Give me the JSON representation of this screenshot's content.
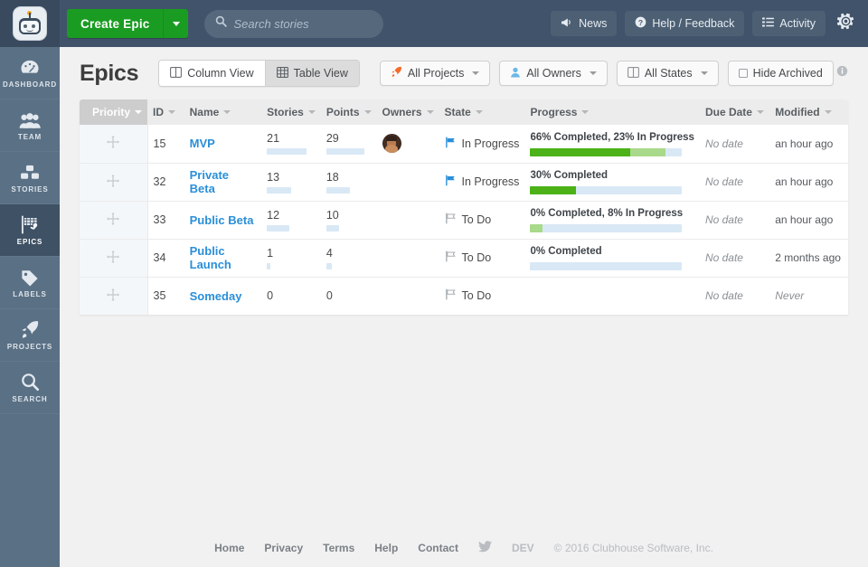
{
  "topbar": {
    "logo": "clubhouse-robot-logo",
    "create_label": "Create Epic",
    "create_caret": "chevron-down-icon",
    "search": {
      "value": "",
      "placeholder": "Search stories"
    },
    "buttons": [
      {
        "label": "News",
        "icon": "megaphone-icon"
      },
      {
        "label": "Help / Feedback",
        "icon": "help-circle-icon"
      },
      {
        "label": "Activity",
        "icon": "list-icon"
      }
    ],
    "settings_icon": "gear-icon"
  },
  "sidebar": {
    "items": [
      {
        "label": "DASHBOARD",
        "icon": "dashboard-icon",
        "active": false
      },
      {
        "label": "TEAM",
        "icon": "team-icon",
        "active": false
      },
      {
        "label": "STORIES",
        "icon": "stories-icon",
        "active": false
      },
      {
        "label": "EPICS",
        "icon": "epics-flag-icon",
        "active": true
      },
      {
        "label": "LABELS",
        "icon": "label-tag-icon",
        "active": false
      },
      {
        "label": "PROJECTS",
        "icon": "rocket-icon",
        "active": false
      },
      {
        "label": "SEARCH",
        "icon": "search-icon",
        "active": false
      }
    ]
  },
  "toolbar": {
    "title": "Epics",
    "views": [
      {
        "label": "Column View",
        "icon": "columns-icon",
        "active": false
      },
      {
        "label": "Table View",
        "icon": "table-grid-icon",
        "active": true
      }
    ],
    "filters": [
      {
        "label": "All Projects",
        "icon": "rocket-icon",
        "caret": true
      },
      {
        "label": "All Owners",
        "icon": "person-icon",
        "caret": true
      },
      {
        "label": "All States",
        "icon": "columns-icon",
        "caret": true
      },
      {
        "label": "Hide Archived",
        "icon": "checkbox-icon",
        "caret": false
      }
    ],
    "info_icon": "info-icon"
  },
  "table": {
    "columns": [
      {
        "key": "priority",
        "label": "Priority",
        "sorted": true
      },
      {
        "key": "id",
        "label": "ID",
        "sorted": false
      },
      {
        "key": "name",
        "label": "Name",
        "sorted": false
      },
      {
        "key": "stories",
        "label": "Stories",
        "sorted": false
      },
      {
        "key": "points",
        "label": "Points",
        "sorted": false
      },
      {
        "key": "owners",
        "label": "Owners",
        "sorted": false
      },
      {
        "key": "state",
        "label": "State",
        "sorted": false
      },
      {
        "key": "progress",
        "label": "Progress",
        "sorted": false
      },
      {
        "key": "due_date",
        "label": "Due Date",
        "sorted": false
      },
      {
        "key": "modified",
        "label": "Modified",
        "sorted": false
      }
    ],
    "rows": [
      {
        "drag_icon": "drag-handle-icon",
        "id": "15",
        "name": "MVP",
        "stories": "21",
        "stories_pct": 100,
        "points": "29",
        "points_pct": 100,
        "owner_avatar": true,
        "state": "In Progress",
        "state_icon": "flag-filled-icon",
        "progress_label": "66% Completed, 23% In Progress",
        "completed_pct": 66,
        "in_progress_pct": 23,
        "has_progress_bar": true,
        "due_date": "No date",
        "modified": "an hour ago"
      },
      {
        "drag_icon": "drag-handle-icon",
        "id": "32",
        "name": "Private Beta",
        "stories": "13",
        "stories_pct": 62,
        "points": "18",
        "points_pct": 62,
        "owner_avatar": false,
        "state": "In Progress",
        "state_icon": "flag-filled-icon",
        "progress_label": "30% Completed",
        "completed_pct": 30,
        "in_progress_pct": 0,
        "has_progress_bar": true,
        "due_date": "No date",
        "modified": "an hour ago"
      },
      {
        "drag_icon": "drag-handle-icon",
        "id": "33",
        "name": "Public Beta",
        "stories": "12",
        "stories_pct": 57,
        "points": "10",
        "points_pct": 34,
        "owner_avatar": false,
        "state": "To Do",
        "state_icon": "flag-outline-icon",
        "progress_label": "0% Completed, 8% In Progress",
        "completed_pct": 0,
        "in_progress_pct": 8,
        "has_progress_bar": true,
        "due_date": "No date",
        "modified": "an hour ago"
      },
      {
        "drag_icon": "drag-handle-icon",
        "id": "34",
        "name": "Public Launch",
        "stories": "1",
        "stories_pct": 5,
        "points": "4",
        "points_pct": 14,
        "owner_avatar": false,
        "state": "To Do",
        "state_icon": "flag-outline-icon",
        "progress_label": "0% Completed",
        "completed_pct": 0,
        "in_progress_pct": 0,
        "has_progress_bar": true,
        "due_date": "No date",
        "modified": "2 months ago"
      },
      {
        "drag_icon": "drag-handle-icon",
        "id": "35",
        "name": "Someday",
        "stories": "0",
        "stories_pct": 0,
        "points": "0",
        "points_pct": 0,
        "owner_avatar": false,
        "state": "To Do",
        "state_icon": "flag-outline-icon",
        "progress_label": "",
        "completed_pct": 0,
        "in_progress_pct": 0,
        "has_progress_bar": false,
        "due_date": "No date",
        "modified": "Never"
      }
    ]
  },
  "footer": {
    "links": [
      "Home",
      "Privacy",
      "Terms",
      "Help",
      "Contact"
    ],
    "twitter_icon": "twitter-bird-icon",
    "env": "DEV",
    "copyright": "© 2016 Clubhouse Software, Inc."
  },
  "colors": {
    "header_bg": "#41536a",
    "sidebar_bg": "#5a7085",
    "sidebar_active": "#3f5165",
    "create_green": "#1a9c22",
    "link_blue": "#2a8fd8",
    "progress_done": "#4cb217",
    "progress_inprogress": "#a9d98a",
    "progress_track": "#d9e8f5",
    "flag_blue": "#2a8fd8"
  }
}
